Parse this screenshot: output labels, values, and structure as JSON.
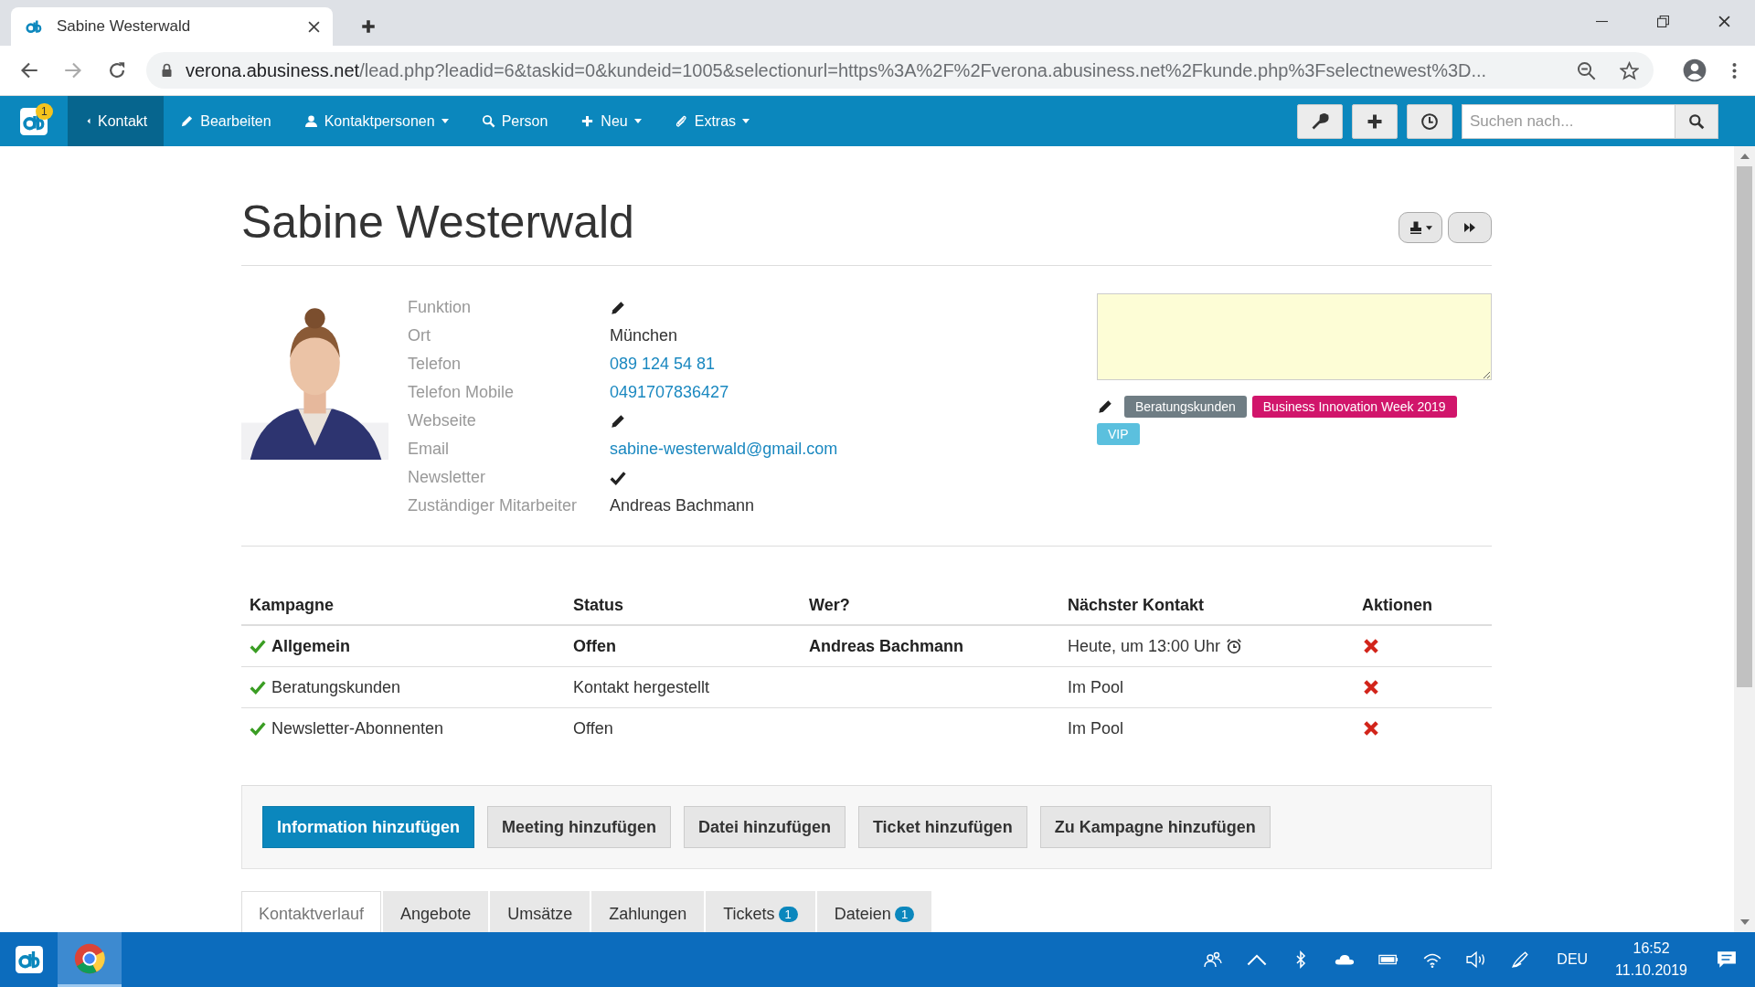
{
  "browser": {
    "tab_title": "Sabine Westerwald",
    "url_host": "verona.abusiness.net",
    "url_path": "/lead.php?leadid=6&taskid=0&kundeid=1005&selectionurl=https%3A%2F%2Fverona.abusiness.net%2Fkunde.php%3Fselectnewest%3D..."
  },
  "nav": {
    "notification_count": "1",
    "items": [
      {
        "label": "Kontakt",
        "caret": false,
        "selected": true
      },
      {
        "label": "Bearbeiten",
        "caret": false,
        "selected": false
      },
      {
        "label": "Kontaktpersonen",
        "caret": true,
        "selected": false
      },
      {
        "label": "Person",
        "caret": false,
        "selected": false
      },
      {
        "label": "Neu",
        "caret": true,
        "selected": false
      },
      {
        "label": "Extras",
        "caret": true,
        "selected": false
      }
    ],
    "search": {
      "placeholder": "Suchen nach..."
    }
  },
  "title": "Sabine Westerwald",
  "details": [
    {
      "label": "Funktion",
      "kind": "edit"
    },
    {
      "label": "Ort",
      "kind": "text",
      "value": "München"
    },
    {
      "label": "Telefon",
      "kind": "link",
      "value": "089 124 54 81"
    },
    {
      "label": "Telefon Mobile",
      "kind": "link",
      "value": "0491707836427"
    },
    {
      "label": "Webseite",
      "kind": "edit"
    },
    {
      "label": "Email",
      "kind": "link",
      "value": "sabine-westerwald@gmail.com"
    },
    {
      "label": "Newsletter",
      "kind": "check"
    },
    {
      "label": "Zuständiger Mitarbeiter",
      "kind": "text",
      "value": "Andreas Bachmann"
    }
  ],
  "tags": [
    {
      "label": "Beratungskunden",
      "color": "#6f7d84"
    },
    {
      "label": "Business Innovation Week 2019",
      "color": "#d1156b"
    },
    {
      "label": "VIP",
      "color": "#5bc0de"
    }
  ],
  "table": {
    "columns": [
      "Kampagne",
      "Status",
      "Wer?",
      "Nächster Kontakt",
      "Aktionen"
    ],
    "rows": [
      {
        "bold": true,
        "campaign": "Allgemein",
        "status": "Offen",
        "who": "Andreas Bachmann",
        "next": "Heute, um 13:00 Uhr",
        "reminder": true
      },
      {
        "bold": false,
        "campaign": "Beratungskunden",
        "status": "Kontakt hergestellt",
        "who": "",
        "next": "Im Pool",
        "reminder": false
      },
      {
        "bold": false,
        "campaign": "Newsletter-Abonnenten",
        "status": "Offen",
        "who": "",
        "next": "Im Pool",
        "reminder": false
      }
    ]
  },
  "actions": [
    {
      "label": "Information hinzufügen",
      "primary": true
    },
    {
      "label": "Meeting hinzufügen",
      "primary": false
    },
    {
      "label": "Datei hinzufügen",
      "primary": false
    },
    {
      "label": "Ticket hinzufügen",
      "primary": false
    },
    {
      "label": "Zu Kampagne hinzufügen",
      "primary": false
    }
  ],
  "tabs": [
    {
      "label": "Kontaktverlauf",
      "selected": true
    },
    {
      "label": "Angebote",
      "selected": false
    },
    {
      "label": "Umsätze",
      "selected": false
    },
    {
      "label": "Zahlungen",
      "selected": false
    },
    {
      "label": "Tickets",
      "selected": false,
      "badge": "1"
    },
    {
      "label": "Dateien",
      "selected": false,
      "badge": "1"
    }
  ],
  "taskbar": {
    "language": "DEU",
    "time": "16:52",
    "date": "11.10.2019"
  }
}
